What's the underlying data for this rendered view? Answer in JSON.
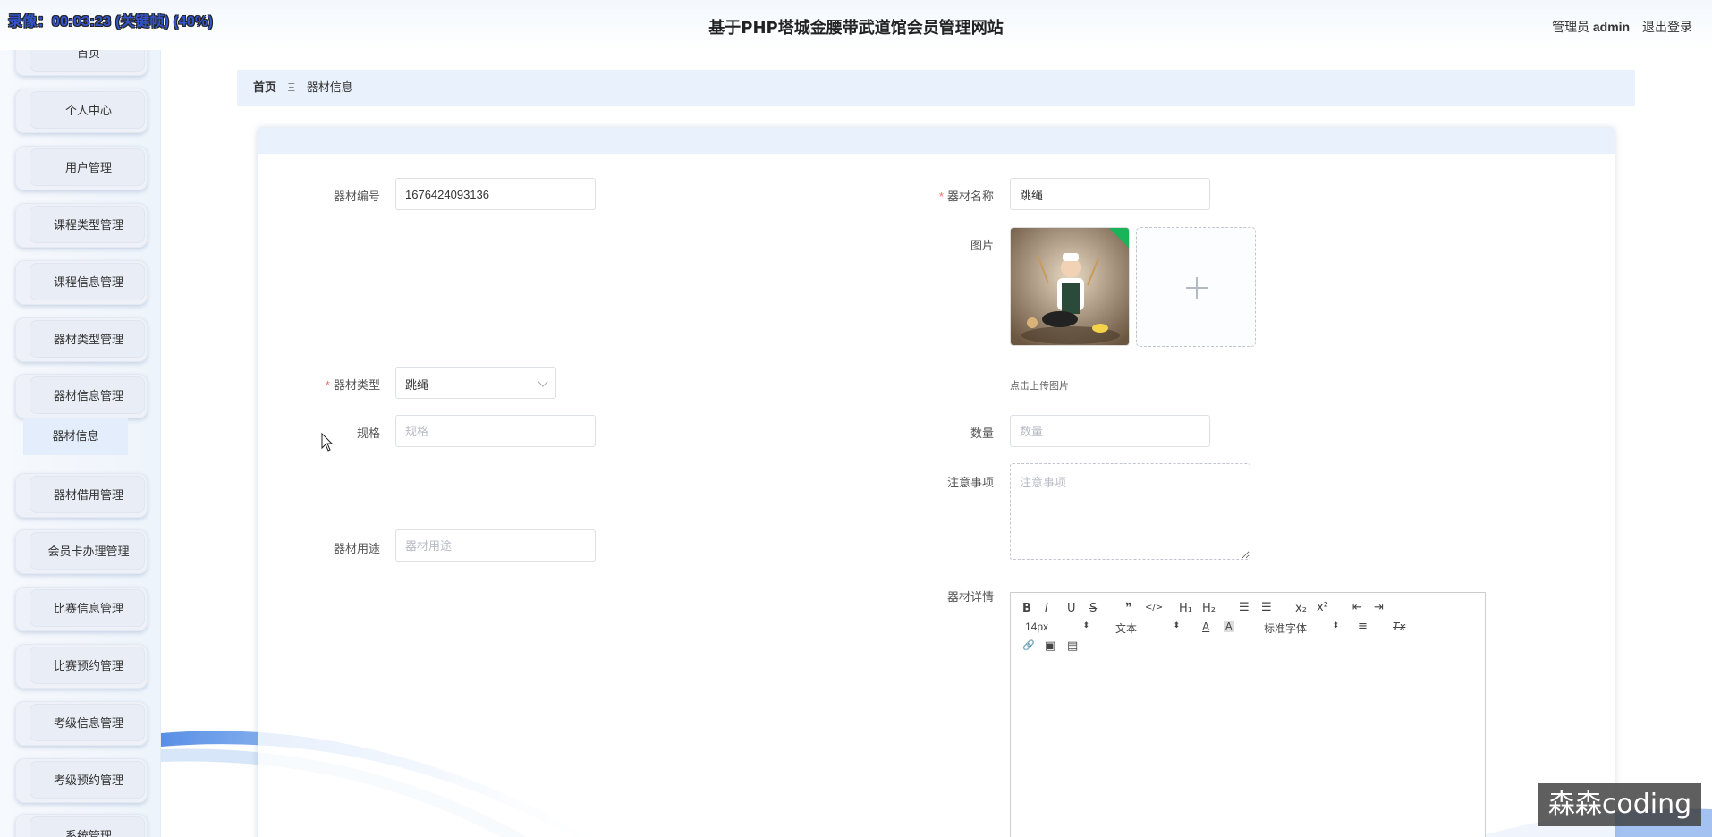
{
  "header": {
    "recorder_status": "录像：00:03:23 (关键帧) (40%)",
    "site_title": "基于PHP塔城金腰带武道馆会员管理网站",
    "role": "管理员",
    "username": "admin",
    "logout": "退出登录"
  },
  "sidebar": {
    "items": [
      {
        "label": "首页"
      },
      {
        "label": "个人中心"
      },
      {
        "label": "用户管理"
      },
      {
        "label": "课程类型管理"
      },
      {
        "label": "课程信息管理"
      },
      {
        "label": "器材类型管理"
      },
      {
        "label": "器材信息管理"
      },
      {
        "label": "器材借用管理"
      },
      {
        "label": "会员卡办理管理"
      },
      {
        "label": "比赛信息管理"
      },
      {
        "label": "比赛预约管理"
      },
      {
        "label": "考级信息管理"
      },
      {
        "label": "考级预约管理"
      },
      {
        "label": "系统管理"
      }
    ],
    "active_sub": "器材信息"
  },
  "breadcrumb": {
    "home": "首页",
    "separator": "Ξ",
    "current": "器材信息"
  },
  "form": {
    "code": {
      "label": "器材编号",
      "value": "1676424093136"
    },
    "name": {
      "label": "器材名称",
      "value": "跳绳"
    },
    "picture": {
      "label": "图片",
      "upload_hint": "点击上传图片"
    },
    "type": {
      "label": "器材类型",
      "value": "跳绳"
    },
    "spec": {
      "label": "规格",
      "placeholder": "规格"
    },
    "quantity": {
      "label": "数量",
      "placeholder": "数量"
    },
    "notes": {
      "label": "注意事项",
      "placeholder": "注意事项"
    },
    "usage": {
      "label": "器材用途",
      "placeholder": "器材用途"
    },
    "detail": {
      "label": "器材详情"
    }
  },
  "editor_toolbar": {
    "bold": "B",
    "italic": "I",
    "underline": "U",
    "strike": "S",
    "quote": "❞",
    "code": "</>",
    "h1": "H₁",
    "h2": "H₂",
    "ordered_list": "☰",
    "bullet_list": "☰",
    "subscript": "x₂",
    "superscript": "x²",
    "outdent": "⇤",
    "indent": "⇥",
    "size": "14px",
    "header": "文本",
    "color": "A",
    "background": "A",
    "font": "标准字体",
    "align": "≡",
    "clean": "Tx",
    "link": "🔗",
    "image": "▣",
    "video": "▤"
  },
  "watermark": "森森coding",
  "colors": {
    "accent_bg": "#e8f1fc",
    "required": "#f56c6c",
    "wave": "#2f6fd8"
  }
}
